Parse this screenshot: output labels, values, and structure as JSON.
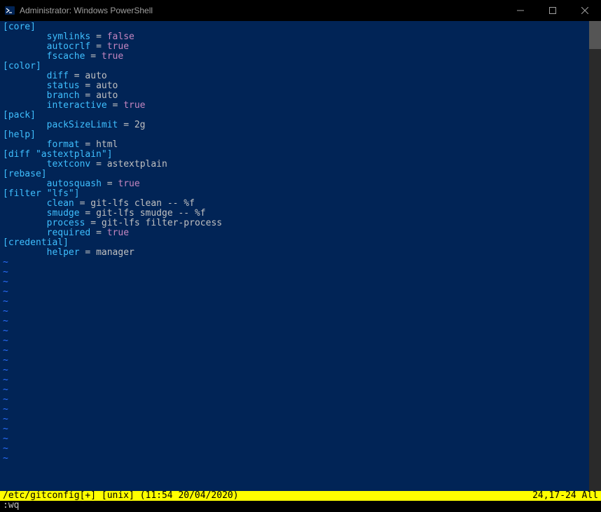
{
  "window": {
    "title": "Administrator: Windows PowerShell"
  },
  "config": {
    "indent": "        ",
    "sections": [
      {
        "name": "core",
        "entries": [
          {
            "key": "symlinks",
            "value": "false",
            "bool": true
          },
          {
            "key": "autocrlf",
            "value": "true",
            "bool": true
          },
          {
            "key": "fscache",
            "value": "true",
            "bool": true
          }
        ]
      },
      {
        "name": "color",
        "entries": [
          {
            "key": "diff",
            "value": "auto",
            "bool": false
          },
          {
            "key": "status",
            "value": "auto",
            "bool": false
          },
          {
            "key": "branch",
            "value": "auto",
            "bool": false
          },
          {
            "key": "interactive",
            "value": "true",
            "bool": true
          }
        ]
      },
      {
        "name": "pack",
        "entries": [
          {
            "key": "packSizeLimit",
            "value": "2g",
            "bool": false
          }
        ]
      },
      {
        "name": "help",
        "entries": [
          {
            "key": "format",
            "value": "html",
            "bool": false
          }
        ]
      },
      {
        "name": "diff \"astextplain\"",
        "entries": [
          {
            "key": "textconv",
            "value": "astextplain",
            "bool": false
          }
        ]
      },
      {
        "name": "rebase",
        "entries": [
          {
            "key": "autosquash",
            "value": "true",
            "bool": true
          }
        ]
      },
      {
        "name": "filter \"lfs\"",
        "entries": [
          {
            "key": "clean",
            "value": "git-lfs clean -- %f",
            "bool": false
          },
          {
            "key": "smudge",
            "value": "git-lfs smudge -- %f",
            "bool": false
          },
          {
            "key": "process",
            "value": "git-lfs filter-process",
            "bool": false
          },
          {
            "key": "required",
            "value": "true",
            "bool": true
          }
        ]
      },
      {
        "name": "credential",
        "entries": [
          {
            "key": "helper",
            "value": "manager",
            "bool": false
          }
        ]
      }
    ]
  },
  "tilde_rows": 21,
  "statusbar": {
    "left": "/etc/gitconfig[+] [unix] (11:54 20/04/2020)",
    "right": "24,17-24 All"
  },
  "cmdline": ":wq"
}
